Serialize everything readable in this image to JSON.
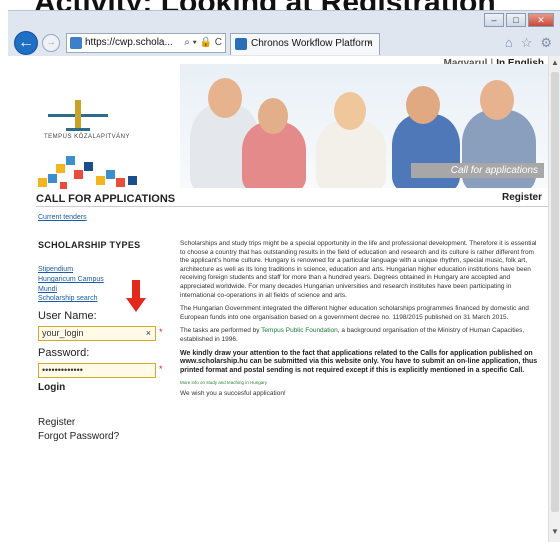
{
  "cut_title": "Activity: Looking at Registration",
  "browser": {
    "address": "https://cwp.schola...",
    "address_tools": "⌕ ▾ 🔒 C",
    "tab_title": "Chronos Workflow Platform",
    "tab_close": "×",
    "window_buttons": [
      "–",
      "□",
      "✕"
    ],
    "right_tools": [
      "⌂",
      "☆",
      "⚙"
    ]
  },
  "lang": {
    "hu": "Magyarul",
    "sep": "|",
    "en": "In English"
  },
  "logo": {
    "text": "TEMPUS KÖZALAPITVÁNY"
  },
  "header": {
    "call_for_applications": "CALL FOR APPLICATIONS",
    "banner_caption": "Call for applications",
    "register": "Register"
  },
  "sidebar": {
    "current_tenders": "Current tenders",
    "scholarship_types": "SCHOLARSHIP TYPES",
    "link_stipendium": "Stipendium Hungaricum Campus Mundi",
    "link_search": "Scholarship search",
    "username_label": "User Name:",
    "username_value": "your_login",
    "clear": "×",
    "password_label": "Password:",
    "password_value": "•••••••••••••",
    "required": "*",
    "login": "Login",
    "register": "Register",
    "forgot": "Forgot Password?"
  },
  "main": {
    "p1": "Scholarships and study trips might be a special opportunity in the life and professional development. Therefore it is essential to choose a country that has outstanding results in the field of education and research and its culture is rather different from the applicant's home culture. Hungary is renowned for a particular language with a unique rhythm, special music, folk art, architecture as well as its long traditions in science, education and arts. Hungarian higher education institutions have been receiving foreign students and staff for more than a hundred years. Degrees obtained in Hungary are accepted and appreciated worldwide. For many decades Hungarian universities and research institutes have been participating in international co-operations in all fields of science and arts.",
    "p2": "The Hungarian Government integrated the different higher education scholarships programmes financed by domestic and European funds into one organisation based on a government decree no. 1198/2015 published on 31 March 2015.",
    "p3_a": "The tasks are performed by ",
    "p3_link": "Tempus Public Foundation",
    "p3_b": ", a background organisation of the Ministry of Human Capacities, established in 1996.",
    "p4": "We kindly draw your attention to the fact that applications related to the Calls for application published on www.scholarship.hu can be submitted via this website only. You have to submit an on-line application, thus printed format and postal sending is not required except if this is explicitly mentioned in a specific Call.",
    "p5": "More info on study and teaching in Hungary",
    "p6": "We wish you a succesful application!"
  },
  "colors": {
    "accent_link": "#1a5aa6",
    "arrow": "#e3281c",
    "input_border": "#d9a72a"
  }
}
